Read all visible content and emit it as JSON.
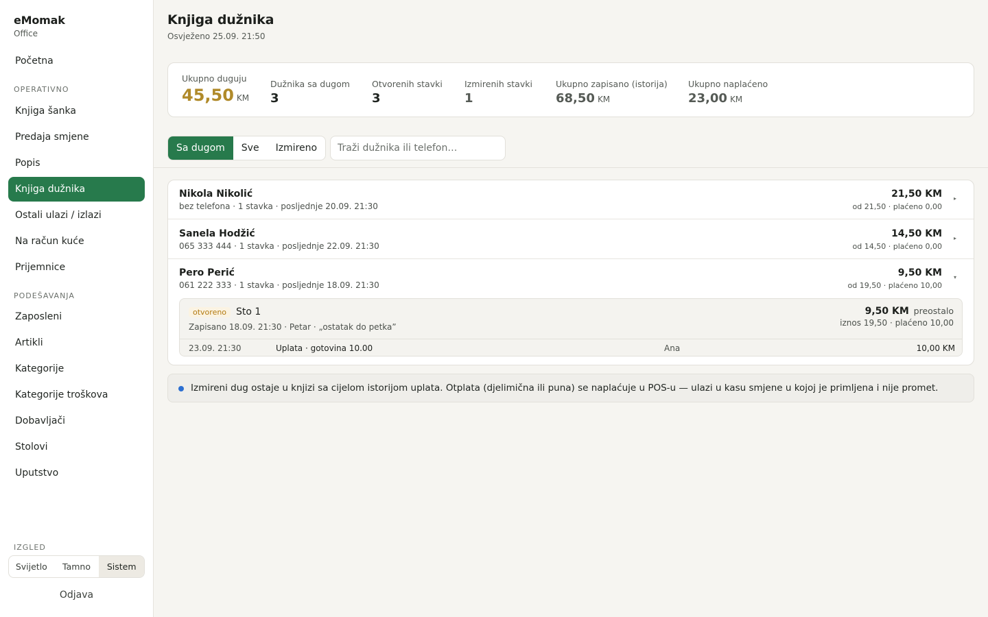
{
  "brand": {
    "name": "eMomak",
    "sub": "Office"
  },
  "nav": {
    "home": "Početna",
    "section_operational": "OPERATIVNO",
    "operational": [
      "Knjiga šanka",
      "Predaja smjene",
      "Popis",
      "Knjiga dužnika",
      "Ostali ulazi / izlazi",
      "Na račun kuće",
      "Prijemnice"
    ],
    "section_settings": "PODEŠAVANJA",
    "settings": [
      "Zaposleni",
      "Artikli",
      "Kategorije",
      "Kategorije troškova",
      "Dobavljači",
      "Stolovi",
      "Uputstvo"
    ],
    "active_item": "Knjiga dužnika"
  },
  "appearance": {
    "label": "IZGLED",
    "options": [
      "Svijetlo",
      "Tamno",
      "Sistem"
    ],
    "selected": "Sistem"
  },
  "logout_label": "Odjava",
  "header": {
    "title": "Knjiga dužnika",
    "refreshed": "Osvježeno 25.09. 21:50"
  },
  "stats": [
    {
      "label": "Ukupno duguju",
      "value": "45,50",
      "unit": "KM"
    },
    {
      "label": "Dužnika sa dugom",
      "value": "3"
    },
    {
      "label": "Otvorenih stavki",
      "value": "3"
    },
    {
      "label": "Izmirenih stavki",
      "value": "1"
    },
    {
      "label": "Ukupno zapisano (istorija)",
      "value": "68,50",
      "unit": "KM"
    },
    {
      "label": "Ukupno naplaćeno",
      "value": "23,00",
      "unit": "KM"
    }
  ],
  "filters": {
    "tabs": [
      "Sa dugom",
      "Sve",
      "Izmireno"
    ],
    "selected": "Sa dugom"
  },
  "search": {
    "placeholder": "Traži dužnika ili telefon…",
    "value": ""
  },
  "debtors": [
    {
      "name": "Nikola Nikolić",
      "meta": "bez telefona · 1 stavka · posljednje 20.09. 21:30",
      "amount": "21,50 KM",
      "sub": "od 21,50 · plaćeno 0,00",
      "expanded": false
    },
    {
      "name": "Sanela Hodžić",
      "meta": "065 333 444 · 1 stavka · posljednje 22.09. 21:30",
      "amount": "14,50 KM",
      "sub": "od 14,50 · plaćeno 0,00",
      "expanded": false
    },
    {
      "name": "Pero Perić",
      "meta": "061 222 333 · 1 stavka · posljednje 18.09. 21:30",
      "amount": "9,50 KM",
      "sub": "od 19,50 · plaćeno 10,00",
      "expanded": true
    }
  ],
  "open_item": {
    "status": "otvoreno",
    "title": "Sto 1",
    "meta": "Zapisano 18.09. 21:30 · Petar · „ostatak do petka”",
    "remaining_amount": "9,50 KM",
    "remaining_label": "preostalo",
    "sub": "iznos 19,50 · plaćeno 10,00",
    "status_color": "#b27a10"
  },
  "payment": {
    "date": "23.09. 21:30",
    "desc": "Uplata · gotovina 10.00",
    "user": "Ana",
    "amount": "10,00 KM"
  },
  "info_text": "Izmireni dug ostaje u knjizi sa cijelom istorijom uplata. Otplata (djelimična ili puna) se naplaćuje u POS-u — ulazi u kasu smjene u kojoj je primljena i nije promet.",
  "colors": {
    "accent": "#277a4c",
    "total_debt": "#b08a2a",
    "info_dot": "#2c6fd1"
  }
}
